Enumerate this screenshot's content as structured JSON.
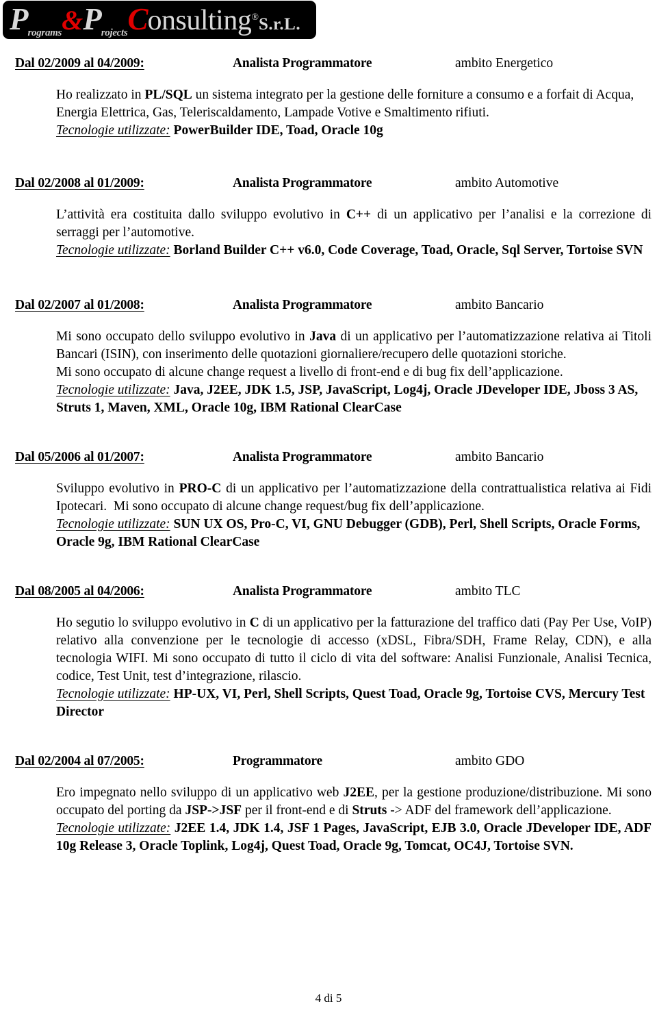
{
  "logo": {
    "p1": "P",
    "p1_sub": "rograms",
    "amp": "&",
    "p2": "P",
    "p2_sub": "rojects",
    "c": "C",
    "word": "onsulting",
    "registered": "®",
    "srl": "S.r.L."
  },
  "entries": [
    {
      "dates": "Dal 02/2009 al 04/2009:",
      "role": "Analista Programmatore",
      "domain": "ambito Energetico",
      "para_before": "Ho realizzato in PL/SQL un sistema integrato per la gestione delle forniture a consumo e a forfait di Acqua, Energia Elettrica, Gas, Teleriscaldamento, Lampade Votive e Smaltimento rifiuti.",
      "para_bold_terms": [
        "PL/SQL"
      ],
      "extra_para": "",
      "tech_label": "Tecnologie utilizzate:",
      "tech_list": "PowerBuilder IDE, Toad, Oracle 10g",
      "justify": false
    },
    {
      "dates": "Dal 02/2008 al 01/2009:",
      "role": "Analista Programmatore",
      "domain": "ambito Automotive",
      "para_before": "L’attività era costituita dallo sviluppo evolutivo in C++ di un applicativo per l’analisi e la correzione di serraggi per l’automotive.",
      "para_bold_terms": [
        "C++"
      ],
      "extra_para": "",
      "tech_label": "Tecnologie utilizzate:",
      "tech_list": "Borland Builder C++ v6.0, Code Coverage, Toad, Oracle, Sql Server, Tortoise SVN",
      "justify": true
    },
    {
      "dates": "Dal 02/2007 al 01/2008:",
      "role": "Analista Programmatore",
      "domain": "ambito Bancario",
      "para_before": "Mi sono occupato dello sviluppo evolutivo in Java di un applicativo per l’automatizzazione relativa ai Titoli Bancari (ISIN), con inserimento delle quotazioni giornaliere/recupero delle quotazioni storiche.",
      "para_bold_terms": [
        "Java"
      ],
      "extra_para": "Mi sono occupato di alcune change request a livello di front-end e di bug fix dell’applicazione.",
      "tech_label": "Tecnologie utilizzate:",
      "tech_list": "Java, J2EE, JDK 1.5, JSP, JavaScript, Log4j, Oracle JDeveloper IDE, Jboss 3 AS, Struts 1, Maven, XML,  Oracle 10g, IBM Rational ClearCase",
      "justify": true
    },
    {
      "dates": "Dal 05/2006 al 01/2007:",
      "role": "Analista Programmatore",
      "domain": "ambito Bancario",
      "para_before": "Sviluppo evolutivo in PRO-C di un applicativo per l’automatizzazione della contrattualistica relativa ai Fidi Ipotecari.  Mi sono occupato di alcune change request/bug fix dell’applicazione.",
      "para_bold_terms": [
        "PRO-C"
      ],
      "extra_para": "",
      "tech_label": "Tecnologie utilizzate:",
      "tech_list": "SUN UX OS, Pro-C, VI, GNU Debugger (GDB), Perl, Shell Scripts, Oracle Forms,  Oracle 9g, IBM Rational ClearCase",
      "justify": true
    },
    {
      "dates": "Dal 08/2005 al 04/2006:",
      "role": "Analista Programmatore",
      "domain": "ambito TLC",
      "para_before": "Ho segutio lo sviluppo evolutivo in C di un applicativo per la fatturazione del traffico dati (Pay Per Use, VoIP) relativo alla convenzione per le tecnologie di accesso (xDSL, Fibra/SDH, Frame Relay, CDN), e alla tecnologia WIFI. Mi sono occupato di tutto il ciclo di vita del software: Analisi Funzionale, Analisi Tecnica, codice, Test Unit, test d’integrazione, rilascio.",
      "para_bold_terms": [
        "C"
      ],
      "extra_para": "",
      "tech_label": "Tecnologie utilizzate:",
      "tech_list": "HP-UX, VI, Perl, Shell Scripts, Quest Toad, Oracle 9g, Tortoise CVS, Mercury Test Director",
      "justify": true
    },
    {
      "dates": "Dal 02/2004 al 07/2005:",
      "role": "Programmatore",
      "domain": "ambito GDO",
      "para_before": "Ero impegnato nello sviluppo di un applicativo web J2EE, per la gestione produzione/distribuzione. Mi sono occupato del porting da JSP->JSF per il front-end e di Struts -> ADF del framework dell’applicazione.",
      "para_bold_terms": [
        "J2EE",
        "JSP->JSF",
        "Struts -"
      ],
      "extra_para": "",
      "tech_label": "Tecnologie utilizzate:",
      "tech_list": "J2EE 1.4, JDK 1.4, JSF 1 Pages, JavaScript, EJB 3.0, Oracle JDeveloper IDE, ADF 10g Release 3, Oracle Toplink, Log4j, Quest Toad, Oracle 9g, Tomcat, OC4J, Tortoise SVN.",
      "justify": true
    }
  ],
  "footer": {
    "page_label": "4 di 5"
  }
}
